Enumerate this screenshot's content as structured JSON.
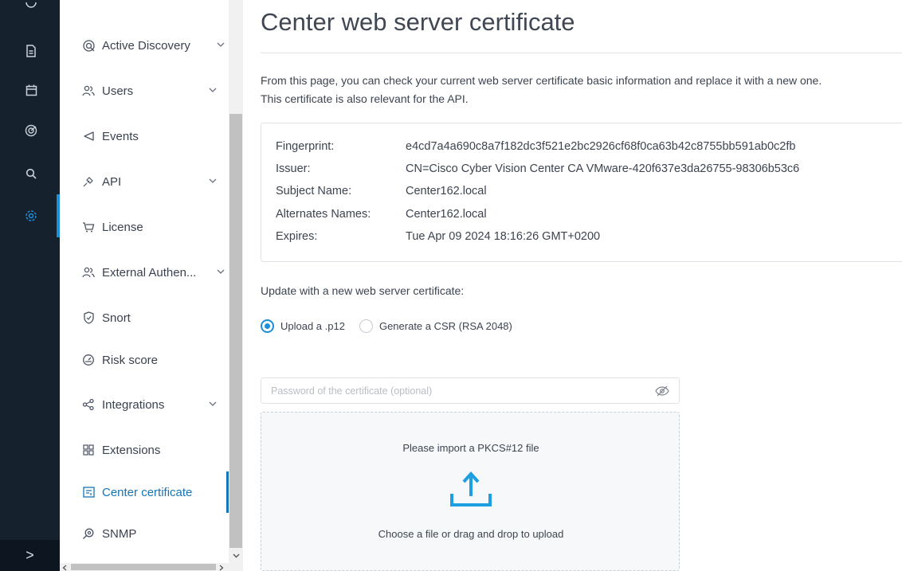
{
  "rail": {
    "icons": [
      "document-icon",
      "calendar-icon",
      "radar-icon",
      "search-icon",
      "settings-icon"
    ],
    "expand_label": ">"
  },
  "sidebar": {
    "items": [
      {
        "label": "Active Discovery",
        "icon": "active-discovery-icon",
        "has_chevron": true
      },
      {
        "label": "Users",
        "icon": "users-icon",
        "has_chevron": true
      },
      {
        "label": "Events",
        "icon": "events-icon",
        "has_chevron": false
      },
      {
        "label": "API",
        "icon": "api-icon",
        "has_chevron": true
      },
      {
        "label": "License",
        "icon": "license-icon",
        "has_chevron": false
      },
      {
        "label": "External Authen...",
        "icon": "external-auth-icon",
        "has_chevron": true
      },
      {
        "label": "Snort",
        "icon": "snort-icon",
        "has_chevron": false
      },
      {
        "label": "Risk score",
        "icon": "risk-score-icon",
        "has_chevron": false
      },
      {
        "label": "Integrations",
        "icon": "integrations-icon",
        "has_chevron": true
      },
      {
        "label": "Extensions",
        "icon": "extensions-icon",
        "has_chevron": false
      },
      {
        "label": "Center certificate",
        "icon": "certificate-icon",
        "has_chevron": false,
        "active": true
      },
      {
        "label": "SNMP",
        "icon": "snmp-icon",
        "has_chevron": false
      }
    ]
  },
  "main": {
    "title": "Center web server certificate",
    "intro_line1": "From this page, you can check your current web server certificate basic information and replace it with a new one.",
    "intro_line2": "This certificate is also relevant for the API.",
    "certificate": {
      "fingerprint_label": "Fingerprint:",
      "fingerprint": "e4cd7a4a690c8a7f182dc3f521e2bc2926cf68f0ca63b42c8755bb591ab0c2fb",
      "issuer_label": "Issuer:",
      "issuer": "CN=Cisco Cyber Vision Center CA VMware-420f637e3da26755-98306b53c6",
      "subject_label": "Subject Name:",
      "subject": "Center162.local",
      "alternates_label": "Alternates Names:",
      "alternates": "Center162.local",
      "expires_label": "Expires:",
      "expires": "Tue Apr 09 2024 18:16:26 GMT+0200"
    },
    "update_label": "Update with a new web server certificate:",
    "radio_upload": "Upload a .p12",
    "radio_csr": "Generate a CSR (RSA 2048)",
    "selected_option": "Upload a .p12",
    "password_placeholder": "Password of the certificate (optional)",
    "dropzone_title": "Please import a PKCS#12 file",
    "dropzone_hint": "Choose a file or drag and drop to upload"
  },
  "colors": {
    "rail_bg": "#16212e",
    "accent": "#1d8ed8",
    "active_text": "#1575b6"
  }
}
